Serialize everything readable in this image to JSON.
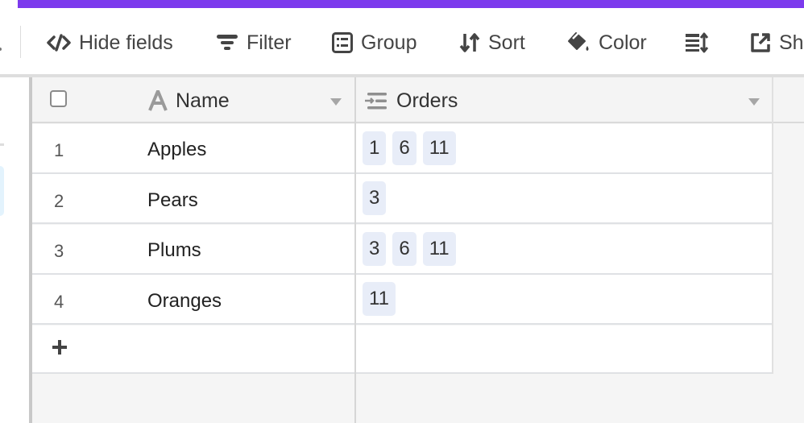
{
  "theme": {
    "accent": "#7c3aed",
    "chip_bg": "#e8edf8"
  },
  "toolbar": {
    "items": [
      {
        "icon": "hide-fields-icon",
        "label": "Hide fields"
      },
      {
        "icon": "filter-icon",
        "label": "Filter"
      },
      {
        "icon": "group-icon",
        "label": "Group"
      },
      {
        "icon": "sort-icon",
        "label": "Sort"
      },
      {
        "icon": "paint-bucket-icon",
        "label": "Color"
      },
      {
        "icon": "row-height-icon",
        "label": ""
      },
      {
        "icon": "share-icon",
        "label": "Sha"
      }
    ]
  },
  "table": {
    "columns": [
      {
        "icon": "text-field-icon",
        "label": "Name"
      },
      {
        "icon": "link-field-icon",
        "label": "Orders"
      }
    ],
    "rows": [
      {
        "num": "1",
        "name": "Apples",
        "orders": [
          "1",
          "6",
          "11"
        ]
      },
      {
        "num": "2",
        "name": "Pears",
        "orders": [
          "3"
        ]
      },
      {
        "num": "3",
        "name": "Plums",
        "orders": [
          "3",
          "6",
          "11"
        ]
      },
      {
        "num": "4",
        "name": "Oranges",
        "orders": [
          "11"
        ]
      }
    ],
    "add_row_icon": "plus-icon"
  }
}
